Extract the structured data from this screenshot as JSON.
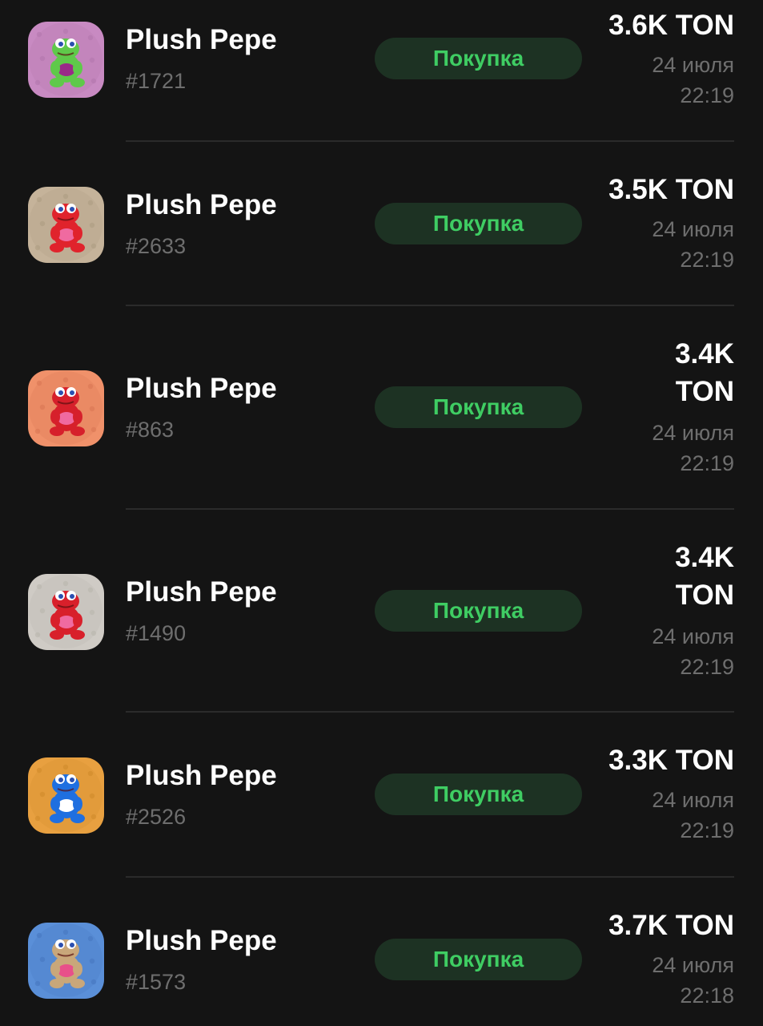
{
  "status_label": "Покупка",
  "items": [
    {
      "name": "Plush Pepe",
      "number": "#1721",
      "price": "3.6K TON",
      "date": "24 июля",
      "time": "22:19",
      "icon": "pepe-green-plush-icon",
      "bg": "#c88ac2",
      "bg2": "#b276ad",
      "body": "#5fc94a",
      "heart": "#9a2a88"
    },
    {
      "name": "Plush Pepe",
      "number": "#2633",
      "price": "3.5K TON",
      "date": "24 июля",
      "time": "22:19",
      "icon": "pepe-red-plush-icon",
      "bg": "#c5b39a",
      "bg2": "#ae9c82",
      "body": "#e0232c",
      "heart": "#f06aa0"
    },
    {
      "name": "Plush Pepe",
      "number": "#863",
      "price_lines": [
        "3.4K",
        "TON"
      ],
      "date": "24 июля",
      "time": "22:19",
      "icon": "pepe-red-plush-icon",
      "bg": "#f0916a",
      "bg2": "#d97654",
      "body": "#d6202b",
      "heart": "#f06aa0"
    },
    {
      "name": "Plush Pepe",
      "number": "#1490",
      "price_lines": [
        "3.4K",
        "TON"
      ],
      "date": "24 июля",
      "time": "22:19",
      "icon": "pepe-red-plush-icon",
      "bg": "#cfcbc5",
      "bg2": "#b9b5ae",
      "body": "#d8202b",
      "heart": "#f06aa0"
    },
    {
      "name": "Plush Pepe",
      "number": "#2526",
      "price": "3.3K TON",
      "date": "24 июля",
      "time": "22:19",
      "icon": "pepe-blue-plush-icon",
      "bg": "#e8a040",
      "bg2": "#d08a2c",
      "body": "#1f6fe0",
      "heart": "#ffffff"
    },
    {
      "name": "Plush Pepe",
      "number": "#1573",
      "price": "3.7K TON",
      "date": "24 июля",
      "time": "22:18",
      "icon": "pepe-tan-plush-icon",
      "bg": "#5a8fd8",
      "bg2": "#4676c0",
      "body": "#c9a77a",
      "heart": "#e8508a"
    }
  ]
}
